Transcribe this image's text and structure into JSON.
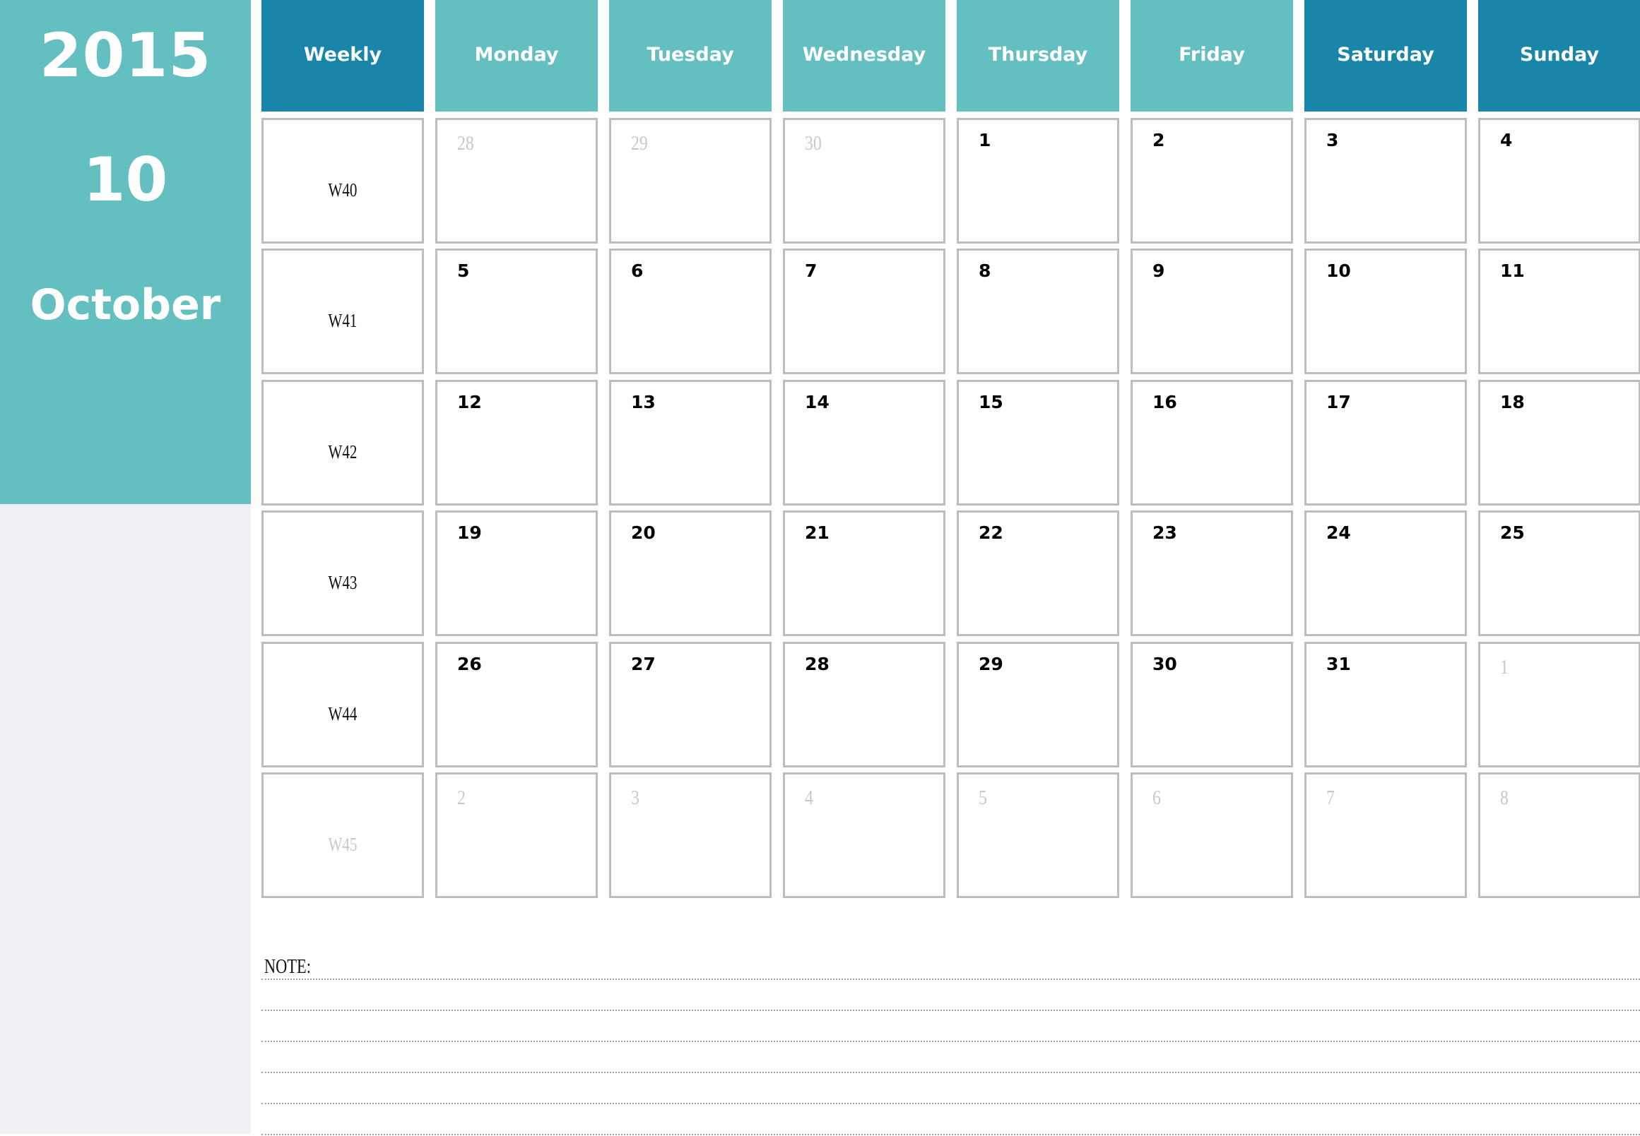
{
  "sidebar": {
    "year": "2015",
    "month_number": "10",
    "month_name": "October"
  },
  "colors": {
    "teal": "#64bfc0",
    "blue": "#1985a9",
    "sidebar_bottom": "#f0eff4",
    "cell_border": "#bdbdbd",
    "faded_text": "#c8c8c8"
  },
  "header": [
    {
      "label": "Weekly",
      "style": "blue"
    },
    {
      "label": "Monday",
      "style": "teal"
    },
    {
      "label": "Tuesday",
      "style": "teal"
    },
    {
      "label": "Wednesday",
      "style": "teal"
    },
    {
      "label": "Thursday",
      "style": "teal"
    },
    {
      "label": "Friday",
      "style": "teal"
    },
    {
      "label": "Saturday",
      "style": "blue"
    },
    {
      "label": "Sunday",
      "style": "blue"
    }
  ],
  "weeks": [
    {
      "label": "W40",
      "faded": false,
      "days": [
        {
          "d": "28",
          "cur": false
        },
        {
          "d": "29",
          "cur": false
        },
        {
          "d": "30",
          "cur": false
        },
        {
          "d": "1",
          "cur": true
        },
        {
          "d": "2",
          "cur": true
        },
        {
          "d": "3",
          "cur": true
        },
        {
          "d": "4",
          "cur": true
        }
      ]
    },
    {
      "label": "W41",
      "faded": false,
      "days": [
        {
          "d": "5",
          "cur": true
        },
        {
          "d": "6",
          "cur": true
        },
        {
          "d": "7",
          "cur": true
        },
        {
          "d": "8",
          "cur": true
        },
        {
          "d": "9",
          "cur": true
        },
        {
          "d": "10",
          "cur": true
        },
        {
          "d": "11",
          "cur": true
        }
      ]
    },
    {
      "label": "W42",
      "faded": false,
      "days": [
        {
          "d": "12",
          "cur": true
        },
        {
          "d": "13",
          "cur": true
        },
        {
          "d": "14",
          "cur": true
        },
        {
          "d": "15",
          "cur": true
        },
        {
          "d": "16",
          "cur": true
        },
        {
          "d": "17",
          "cur": true
        },
        {
          "d": "18",
          "cur": true
        }
      ]
    },
    {
      "label": "W43",
      "faded": false,
      "days": [
        {
          "d": "19",
          "cur": true
        },
        {
          "d": "20",
          "cur": true
        },
        {
          "d": "21",
          "cur": true
        },
        {
          "d": "22",
          "cur": true
        },
        {
          "d": "23",
          "cur": true
        },
        {
          "d": "24",
          "cur": true
        },
        {
          "d": "25",
          "cur": true
        }
      ]
    },
    {
      "label": "W44",
      "faded": false,
      "days": [
        {
          "d": "26",
          "cur": true
        },
        {
          "d": "27",
          "cur": true
        },
        {
          "d": "28",
          "cur": true
        },
        {
          "d": "29",
          "cur": true
        },
        {
          "d": "30",
          "cur": true
        },
        {
          "d": "31",
          "cur": true
        },
        {
          "d": "1",
          "cur": false
        }
      ]
    },
    {
      "label": "W45",
      "faded": true,
      "days": [
        {
          "d": "2",
          "cur": false
        },
        {
          "d": "3",
          "cur": false
        },
        {
          "d": "4",
          "cur": false
        },
        {
          "d": "5",
          "cur": false
        },
        {
          "d": "6",
          "cur": false
        },
        {
          "d": "7",
          "cur": false
        },
        {
          "d": "8",
          "cur": false
        }
      ]
    }
  ],
  "notes": {
    "label": "NOTE:",
    "line_count": 6
  }
}
